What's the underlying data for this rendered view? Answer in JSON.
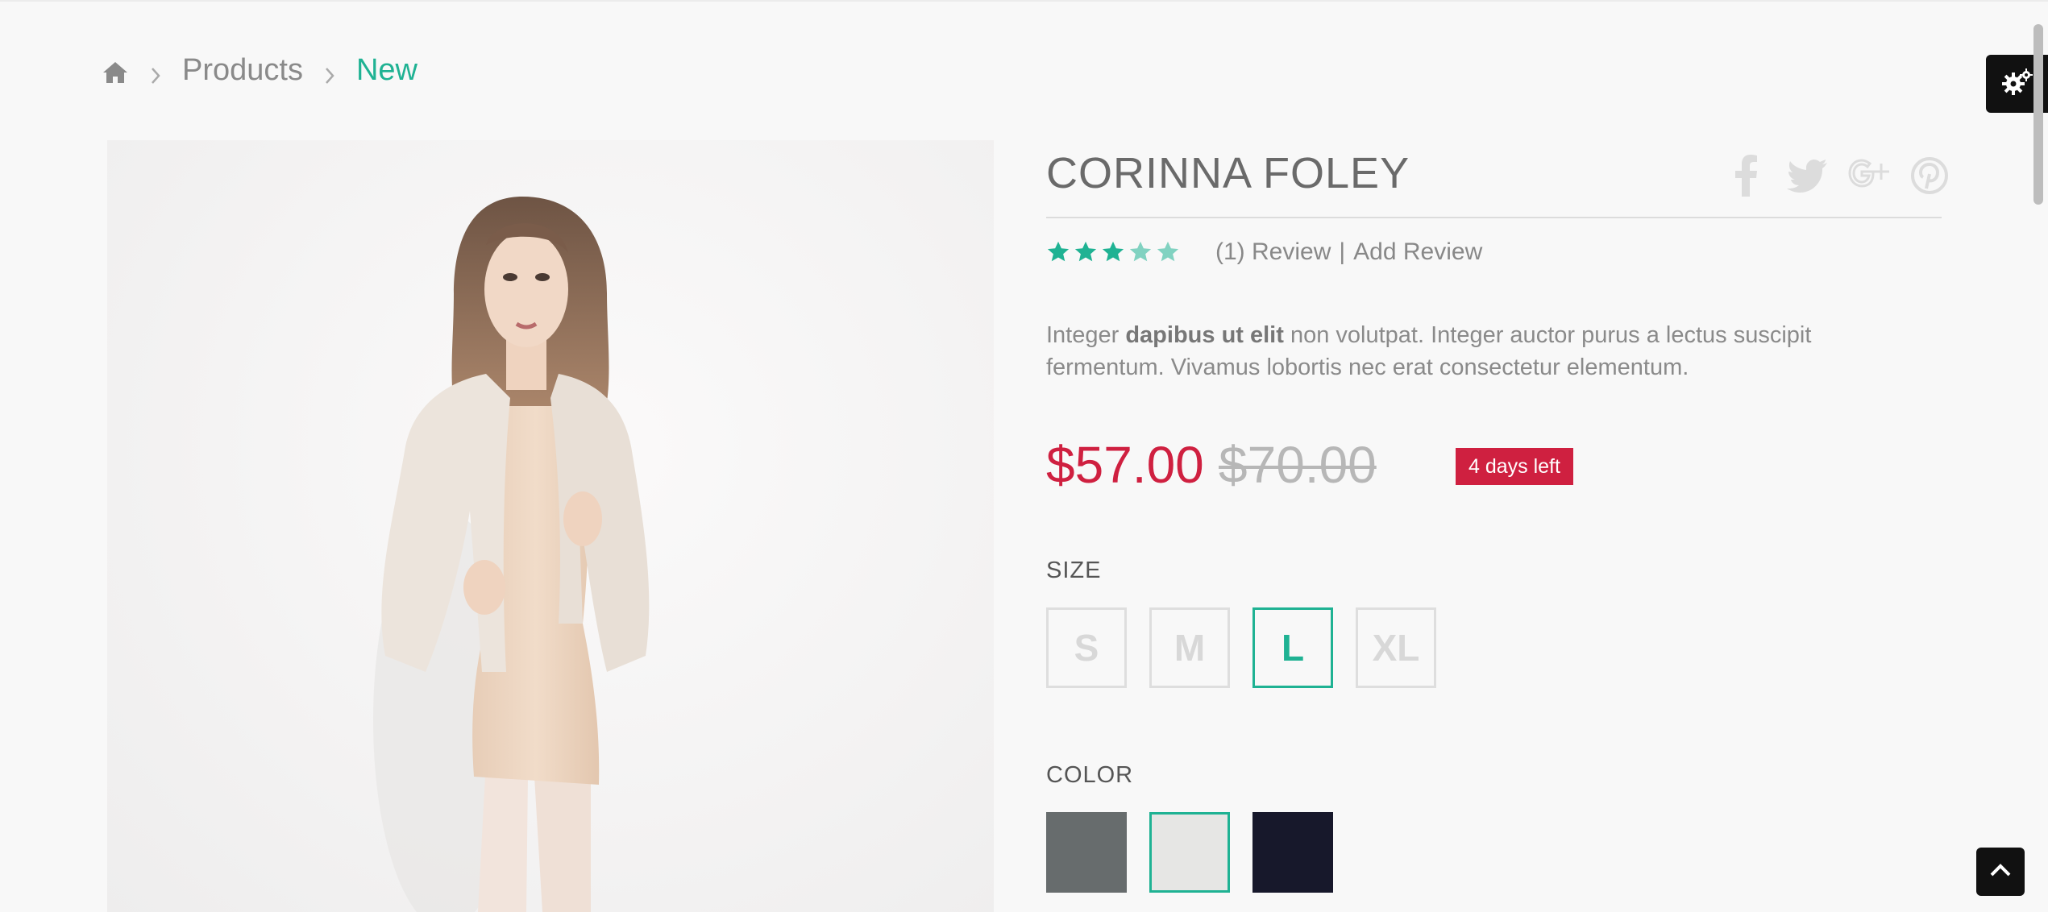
{
  "breadcrumb": {
    "home_icon": "home-icon",
    "items": [
      "Products",
      "New"
    ],
    "active_color": "#1fb293"
  },
  "product": {
    "name": "CORINNA FOLEY",
    "rating": {
      "value": 3,
      "max": 5,
      "color": "#1fb293"
    },
    "review_count_text": "(1) Review",
    "separator": "|",
    "add_review": "Add Review",
    "description_lead": "Integer ",
    "description_bold": "dapibus ut elit",
    "description_rest": " non volutpat. Integer auctor purus a lectus suscipit fermentum. Vivamus lobortis nec erat consectetur elementum.",
    "price": "$57.00",
    "old_price": "$70.00",
    "badge": "4 days left",
    "price_color": "#cf2040"
  },
  "share": {
    "icons": [
      "facebook-icon",
      "twitter-icon",
      "google-plus-icon",
      "pinterest-icon"
    ]
  },
  "size": {
    "label": "SIZE",
    "options": [
      "S",
      "M",
      "L",
      "XL"
    ],
    "selected": "L"
  },
  "color": {
    "label": "COLOR",
    "options": [
      "#676c6d",
      "#e6e6e4",
      "#17182b"
    ],
    "selected_index": 1
  },
  "widgets": {
    "settings_icon": "gears-icon",
    "back_to_top_icon": "chevron-up-icon"
  }
}
